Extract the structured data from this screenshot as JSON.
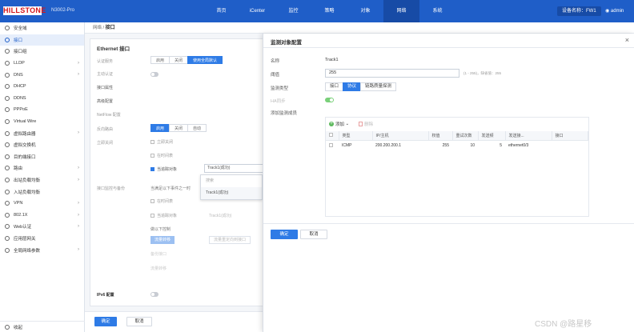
{
  "topbar": {
    "logo": "HILLSTONE",
    "model": "N3002-Pro",
    "nav": [
      "首页",
      "iCenter",
      "监控",
      "策略",
      "对象",
      "网络",
      "系统"
    ],
    "nav_active": 5,
    "device_name": "设备名称：FW1",
    "user": "admin"
  },
  "sidebar": {
    "items": [
      {
        "label": "安全域",
        "arrow": ""
      },
      {
        "label": "接口",
        "arrow": ""
      },
      {
        "label": "接口组",
        "arrow": ""
      },
      {
        "label": "LLDP",
        "arrow": "›"
      },
      {
        "label": "DNS",
        "arrow": "›"
      },
      {
        "label": "DHCP",
        "arrow": ""
      },
      {
        "label": "DDNS",
        "arrow": ""
      },
      {
        "label": "PPPoE",
        "arrow": ""
      },
      {
        "label": "Virtual Wire",
        "arrow": ""
      },
      {
        "label": "虚拟路由器",
        "arrow": "›"
      },
      {
        "label": "虚拟交换机",
        "arrow": ""
      },
      {
        "label": "目的端接口",
        "arrow": ""
      },
      {
        "label": "路由",
        "arrow": "›"
      },
      {
        "label": "出站负载均衡",
        "arrow": "›"
      },
      {
        "label": "入站负载均衡",
        "arrow": ""
      },
      {
        "label": "VPN",
        "arrow": "›"
      },
      {
        "label": "802.1X",
        "arrow": "›"
      },
      {
        "label": "Web认证",
        "arrow": "›"
      },
      {
        "label": "应用层网关",
        "arrow": ""
      },
      {
        "label": "全局网络参数",
        "arrow": "›"
      }
    ],
    "active": 1,
    "footer": "收起"
  },
  "breadcrumb": {
    "parent": "网络 / ",
    "current": "接口"
  },
  "form": {
    "title": "Ethernet 接口",
    "auth_label": "认证服务",
    "auth_options": [
      "启用",
      "关闭",
      "使用全局默认"
    ],
    "arp_label": "主动认证",
    "ifconfig_label": "接口属性",
    "adv_label": "高级配置",
    "netflow_label": "NetFlow 配置",
    "reverse_label": "反向路由",
    "reverse_options": [
      "启用",
      "关闭",
      "自动"
    ],
    "shutdown_label": "立即关闭",
    "cb_immediate": "立即关闭",
    "cb_schedule": "在时间表",
    "cb_track": "当追踪对象",
    "track_select": "Track1(成功)",
    "dropdown_placeholder": "搜索",
    "dropdown_item": "Track1(成功)",
    "backup_label": "接口监控与备份",
    "backup_desc": "当满足以下事件之一时",
    "cb_schedule2": "在时间表",
    "cb_track2": "当追踪对象",
    "track_select2": "Track1(成功)",
    "control_label": "做以下控制",
    "pill_a": "流量转移",
    "pill_b": "流量重定向到接口",
    "sub_label_a": "备份接口",
    "sub_label_b": "流量转移",
    "ipv6_label": "IPv6 配置",
    "ok": "确定",
    "cancel": "取消"
  },
  "modal": {
    "title": "监测对象配置",
    "name_label": "名称",
    "name_value": "Track1",
    "threshold_label": "阈值",
    "threshold_value": "255",
    "threshold_hint": "(1 - 255)，缺省值：255",
    "type_label": "监测类型",
    "type_options": [
      "接口",
      "协议",
      "链路质量探测"
    ],
    "type_active": 1,
    "ha_label": "HA同步",
    "members_label": "添加监测成员",
    "add_btn": "添加",
    "delete_btn": "删除",
    "columns": [
      "",
      "类型",
      "IP/主机",
      "权值",
      "重试次数",
      "发送频",
      "发送接...",
      "接口"
    ],
    "rows": [
      {
        "type": "ICMP",
        "host": "200.200.200.1",
        "weight": "255",
        "retry": "10",
        "freq": "5",
        "iface": "ethernet0/3"
      }
    ],
    "ok": "确定",
    "cancel": "取消"
  },
  "watermark": "CSDN @路星移"
}
